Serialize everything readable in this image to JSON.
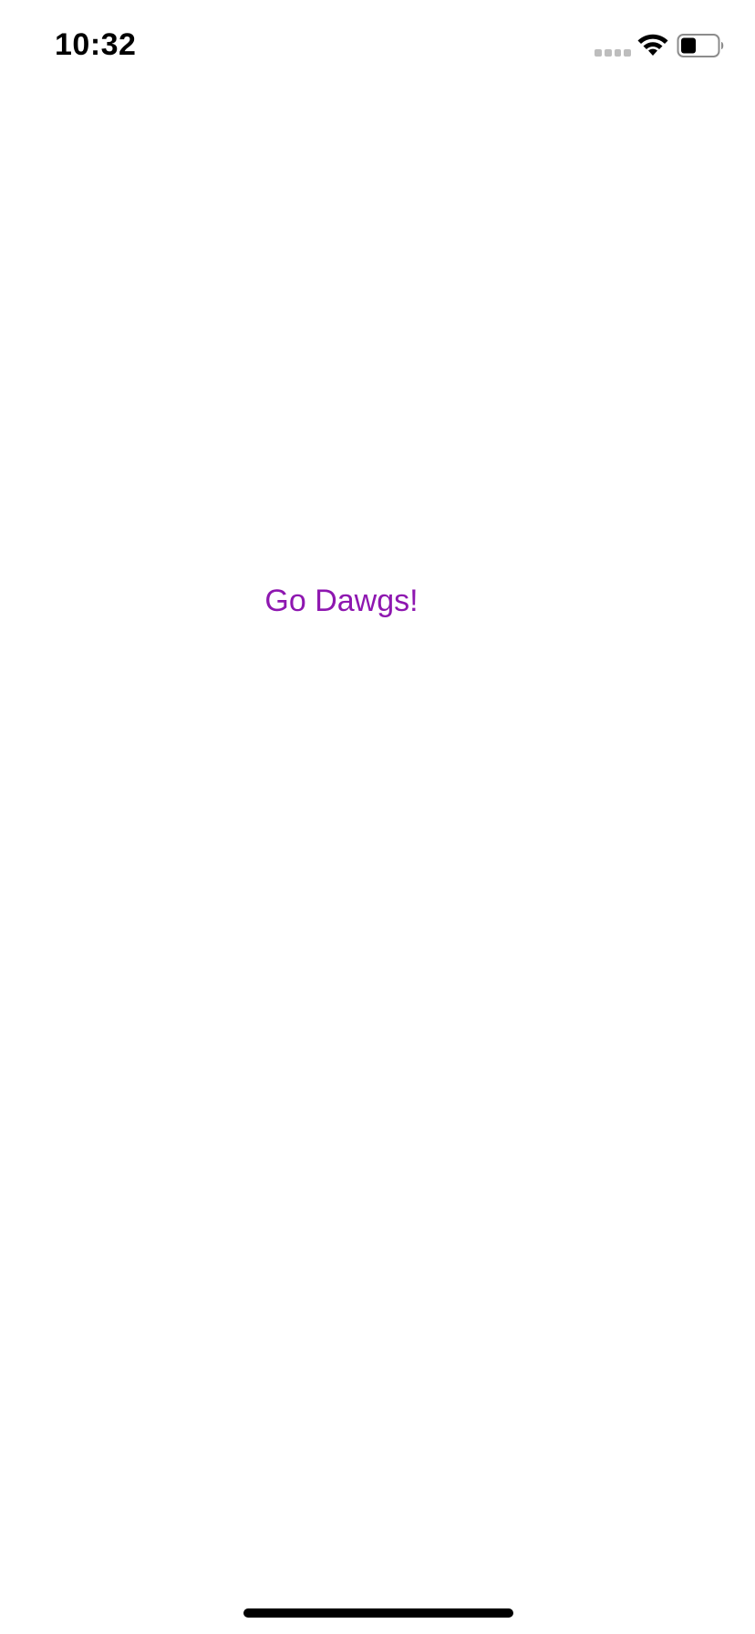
{
  "status_bar": {
    "time": "10:32",
    "signal_icon": "signal-dots-icon",
    "wifi_icon": "wifi-icon",
    "battery_icon": "battery-icon"
  },
  "main": {
    "label": "Go Dawgs!",
    "label_color": "#8e17b0"
  },
  "home_indicator": {
    "icon": "home-indicator"
  }
}
